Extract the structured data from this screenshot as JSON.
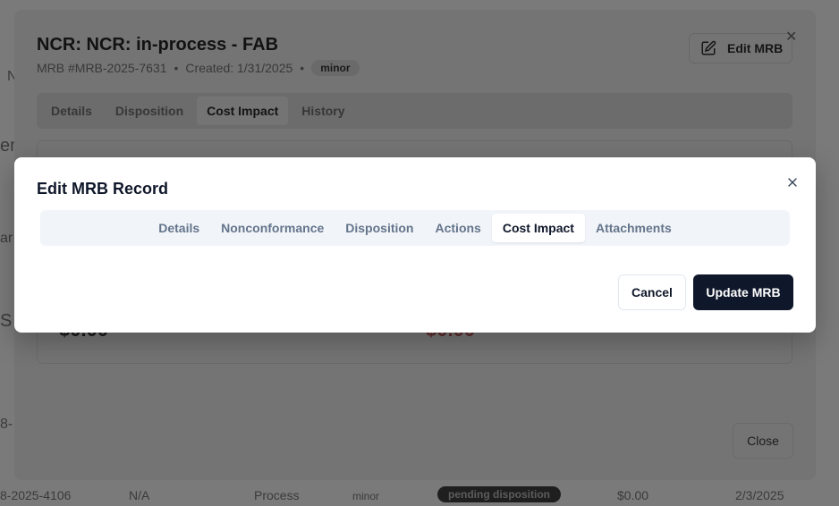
{
  "background": {
    "row": {
      "id": "8-2025-4106",
      "value": "N/A",
      "type": "Process",
      "severity": "minor",
      "status": "pending disposition",
      "cost": "$0.00",
      "date": "2/3/2025"
    },
    "fragments": [
      "N",
      "en",
      "ar",
      "S",
      "8-"
    ]
  },
  "detail_modal": {
    "title": "NCR: NCR: in-process - FAB",
    "mrb_number": "MRB #MRB-2025-7631",
    "created": "Created: 1/31/2025",
    "separator": "•",
    "severity_chip": "minor",
    "edit_button": "Edit MRB",
    "tabs": [
      "Details",
      "Disposition",
      "Cost Impact",
      "History"
    ],
    "active_tab": "Cost Impact",
    "amount_left": "$0.00",
    "amount_right": "$0.00",
    "close_button": "Close"
  },
  "edit_modal": {
    "title": "Edit MRB Record",
    "tabs": [
      "Details",
      "Nonconformance",
      "Disposition",
      "Actions",
      "Cost Impact",
      "Attachments"
    ],
    "active_tab": "Cost Impact",
    "cancel_button": "Cancel",
    "update_button": "Update MRB"
  },
  "colors": {
    "primary": "#0f172a",
    "muted_text": "#64748b",
    "tab_bg": "#f1f5f9",
    "border": "#e2e8f0",
    "overlay": "#6b6b6b"
  }
}
